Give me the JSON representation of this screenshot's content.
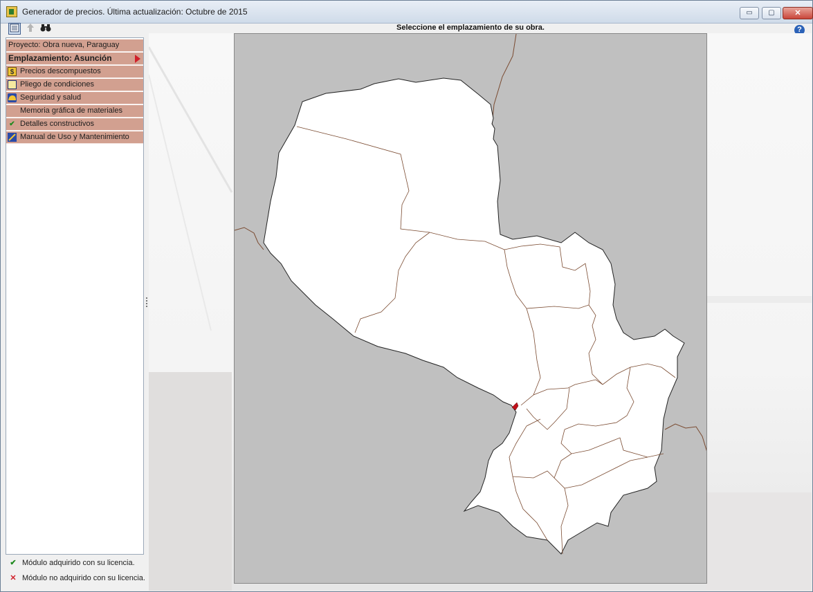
{
  "window": {
    "title": "Generador de precios. Última actualización: Octubre de 2015"
  },
  "window_buttons": {
    "minimize": "▭",
    "maximize": "▢",
    "close": "✕"
  },
  "toolbar": {
    "help": "?"
  },
  "map": {
    "title": "Seleccione el emplazamiento de su obra.",
    "water_color": "#c0c0c0",
    "land_color": "#ffffff",
    "border_color": "#7a4a30",
    "selected_color": "#c0101a"
  },
  "sidebar": {
    "project": "Proyecto: Obra nueva, Paraguay",
    "location": "Emplazamiento: Asunción",
    "items": [
      {
        "label": "Precios descompuestos",
        "icon": "coin-icon"
      },
      {
        "label": "Pliego de condiciones",
        "icon": "document-icon"
      },
      {
        "label": "Seguridad y salud",
        "icon": "helmet-icon"
      },
      {
        "label": "Memoria gráfica de materiales",
        "icon": ""
      },
      {
        "label": "Detalles constructivos",
        "icon": "checkmark-icon"
      },
      {
        "label": "Manual de Uso y Mantenimiento",
        "icon": "tools-icon"
      }
    ]
  },
  "legend": {
    "acquired_mark": "✔",
    "acquired": "Módulo adquirido con su licencia.",
    "not_acquired_mark": "✕",
    "not_acquired": "Módulo no adquirido con su licencia."
  }
}
